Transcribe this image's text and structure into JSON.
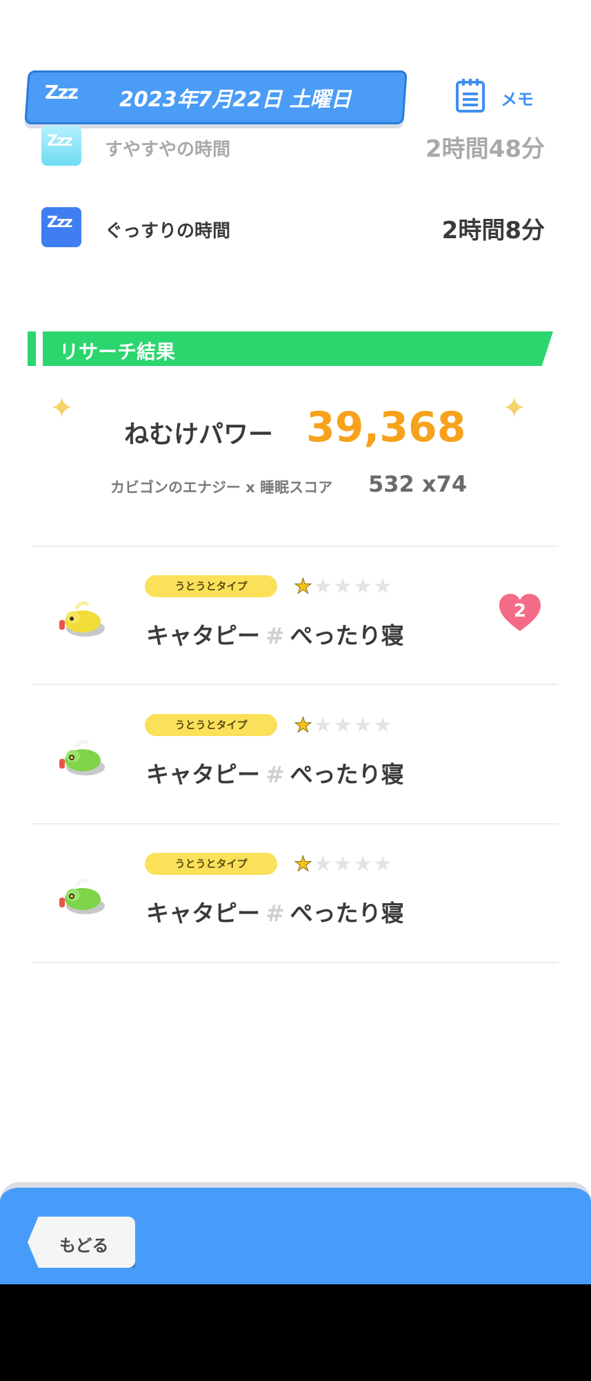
{
  "header": {
    "zzz": "Zzz",
    "date": "2023年7月22日 土曜日",
    "memo_label": "メモ"
  },
  "sleep_stats": [
    {
      "label": "すやすやの時間",
      "value": "2時間48分",
      "color": "#a9a9a9"
    },
    {
      "label": "ぐっすりの時間",
      "value": "2時間8分",
      "color": "#3a3a3a"
    }
  ],
  "research": {
    "title": "リサーチ結果",
    "power_label": "ねむけパワー",
    "power_value": "39,368",
    "calc_label": "カビゴンのエナジー x 睡眠スコア",
    "calc_value": "532 x74"
  },
  "pokemon": [
    {
      "type": "うとうとタイプ",
      "stars": 1,
      "name": "キャタピー",
      "style": "ぺったり寝",
      "color": "yellow",
      "badge": "2"
    },
    {
      "type": "うとうとタイプ",
      "stars": 1,
      "name": "キャタピー",
      "style": "ぺったり寝",
      "color": "green"
    },
    {
      "type": "うとうとタイプ",
      "stars": 1,
      "name": "キャタピー",
      "style": "ぺったり寝",
      "color": "green"
    }
  ],
  "footer": {
    "back_label": "もどる"
  },
  "colors": {
    "primary": "#4a9cf6",
    "research_green": "#2bd66e",
    "power_orange": "#f6a21c",
    "heart_pink": "#f36b86"
  }
}
